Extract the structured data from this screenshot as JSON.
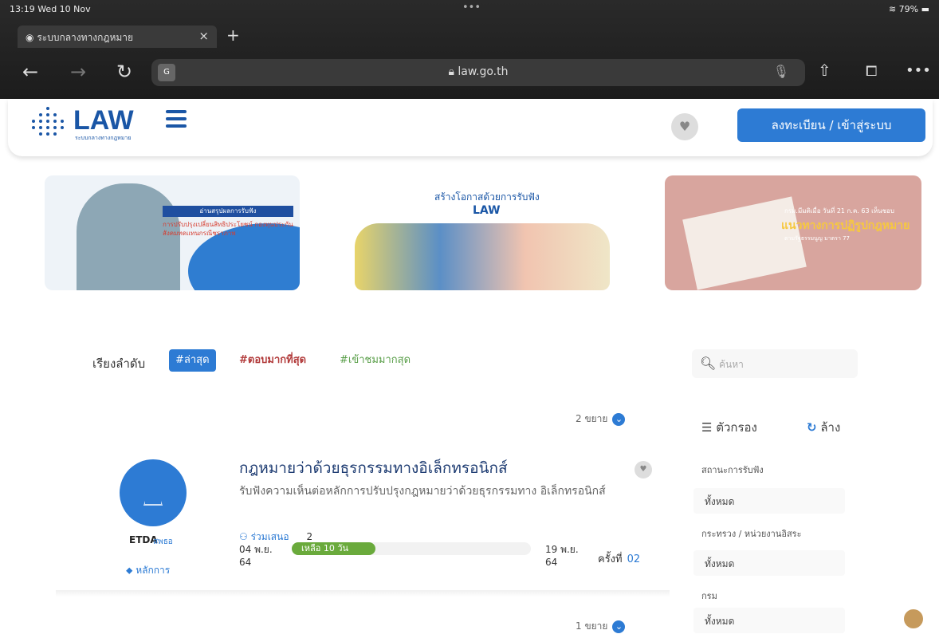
{
  "status_bar": {
    "time": "13:19  Wed 10 Nov",
    "battery": "79%"
  },
  "browser": {
    "tab_title": "ระบบกลางทางกฎหมาย",
    "url": "law.go.th"
  },
  "header": {
    "logo_text": "LAW",
    "logo_sub": "ระบบกลางทางกฎหมาย",
    "login_label": "ลงทะเบียน / เข้าสู่ระบบ"
  },
  "banners": [
    {
      "head": "อ่านสรุปผลการรับฟัง",
      "body": "การปรับปรุงเปลี่ยนสิทธิประโยชน์ กองทุนประกันสังคมทดแทนกรณีชราภาพ"
    },
    {
      "title": "สร้างโอกาสด้วยการรับฟัง",
      "brand": "LAW"
    },
    {
      "line1": "กรม.มีมติเมื่อ วันที่ 21 ก.ค. 63 เห็นชอบ",
      "line2": "แนวทางการปฏิรูปกฎหมาย",
      "line3": "ตามรัฐธรรมนูญ มาตรา 77"
    }
  ],
  "sort": {
    "label": "เรียงลำดับ",
    "options": [
      "#ล่าสุด",
      "#ตอบมากที่สุด",
      "#เข้าชมมากสุด"
    ]
  },
  "search": {
    "placeholder": "ค้นหา"
  },
  "filters": {
    "title": "ตัวกรอง",
    "clear": "ล้าง",
    "groups": [
      {
        "label": "สถานะการรับฟัง",
        "value": "ทั้งหมด"
      },
      {
        "label": "กระทรวง / หน่วยงานอิสระ",
        "value": "ทั้งหมด"
      },
      {
        "label": "กรม",
        "value": "ทั้งหมด"
      }
    ]
  },
  "list": {
    "expand_top": "2 ขยาย",
    "expand_bottom": "1 ขยาย",
    "items": [
      {
        "title": "กฎหมายว่าด้วยธุรกรรมทางอิเล็กทรอนิกส์",
        "desc": "รับฟังความเห็นต่อหลักการปรับปรุงกฎหมายว่าด้วยธุรกรรมทาง อิเล็กทรอนิกส์",
        "org_logo": "ETDA",
        "org_name": "สพธอ",
        "principle": "หลักการ",
        "participants_label": "ร่วมเสนอ",
        "participants": "2",
        "start_date": "04 พ.ย.",
        "start_year": "64",
        "end_date": "19 พ.ย.",
        "end_year": "64",
        "remaining": "เหลือ 10 วัน",
        "remaining_fraction": 0.35,
        "round_label": "ครั้งที่",
        "round": "02"
      }
    ]
  },
  "colors": {
    "primary": "#2d7bd4",
    "brand": "#1a56a6",
    "progress": "#6aaa3c"
  }
}
